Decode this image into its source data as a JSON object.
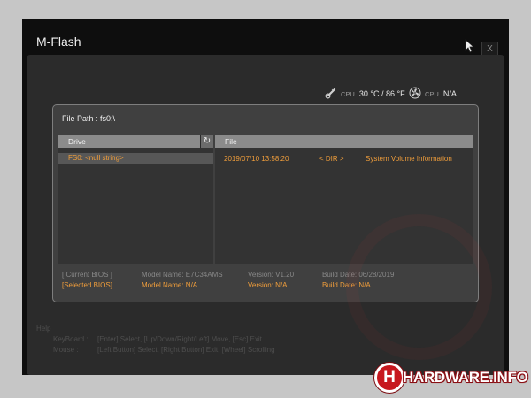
{
  "window": {
    "title": "M-Flash",
    "close_label": "X"
  },
  "status": {
    "cpu_temp_label": "CPU",
    "cpu_temp_value": "30 °C / 86 °F",
    "cpu_fan_label": "CPU",
    "cpu_fan_value": "N/A"
  },
  "dialog": {
    "file_path": "File Path : fs0:\\",
    "drive_header": "Drive",
    "file_header": "File",
    "drives": [
      {
        "label": "FS0: <null string>"
      }
    ],
    "files": [
      {
        "date": "2019/07/10 13:58:20",
        "type": "< DIR >",
        "name": "System Volume Information"
      }
    ],
    "current_bios": {
      "label": "[ Current BIOS  ]",
      "model": "Model Name: E7C34AMS",
      "version": "Version: V1.20",
      "build": "Build Date: 06/28/2019"
    },
    "selected_bios": {
      "label": "[Selected BIOS]",
      "model": "Model Name: N/A",
      "version": "Version: N/A",
      "build": "Build Date: N/A"
    }
  },
  "help": {
    "title": "Help",
    "keyboard_label": "KeyBoard :",
    "keyboard_text": "[Enter]  Select,   [Up/Down/Right/Left]  Move,   [Esc]  Exit",
    "mouse_label": "Mouse    :",
    "mouse_text": "[Left Button]  Select,   [Right Button]  Exit,   [Wheel]  Scrolling"
  },
  "watermark": {
    "icon_letter": "H",
    "text": "HARDWARE.INFO"
  },
  "colors": {
    "accent": "#ef9d3b",
    "header_bar": "#8b8b8b",
    "brand_red": "#c7171e"
  }
}
